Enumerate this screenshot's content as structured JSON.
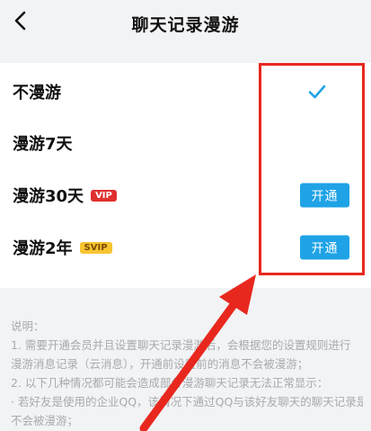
{
  "header": {
    "title": "聊天记录漫游",
    "back_icon": "chevron-left-icon"
  },
  "options": [
    {
      "label": "不漫游",
      "selected": true
    },
    {
      "label": "漫游7天",
      "selected": false
    },
    {
      "label": "漫游30天",
      "badge": "VIP",
      "button": "开通"
    },
    {
      "label": "漫游2年",
      "badge": "SVIP",
      "button": "开通"
    }
  ],
  "notes": [
    "说明：",
    "1. 需要开通会员并且设置聊天记录漫游后，会根据您的设置规则进行",
    "漫游消息记录（云消息），开通前设置前的消息不会被漫游；",
    "2. 以下几种情况都可能会造成部分漫游聊天记录无法正常显示：",
    "· 若好友是使用的企业QQ，该情况下通过QQ与该好友聊天的聊天记录是",
    "不会被漫游；"
  ],
  "colors": {
    "accent": "#1fa3e6",
    "vip": "#e02f2f",
    "svip": "#f7c432",
    "annotation": "#e8281e"
  }
}
